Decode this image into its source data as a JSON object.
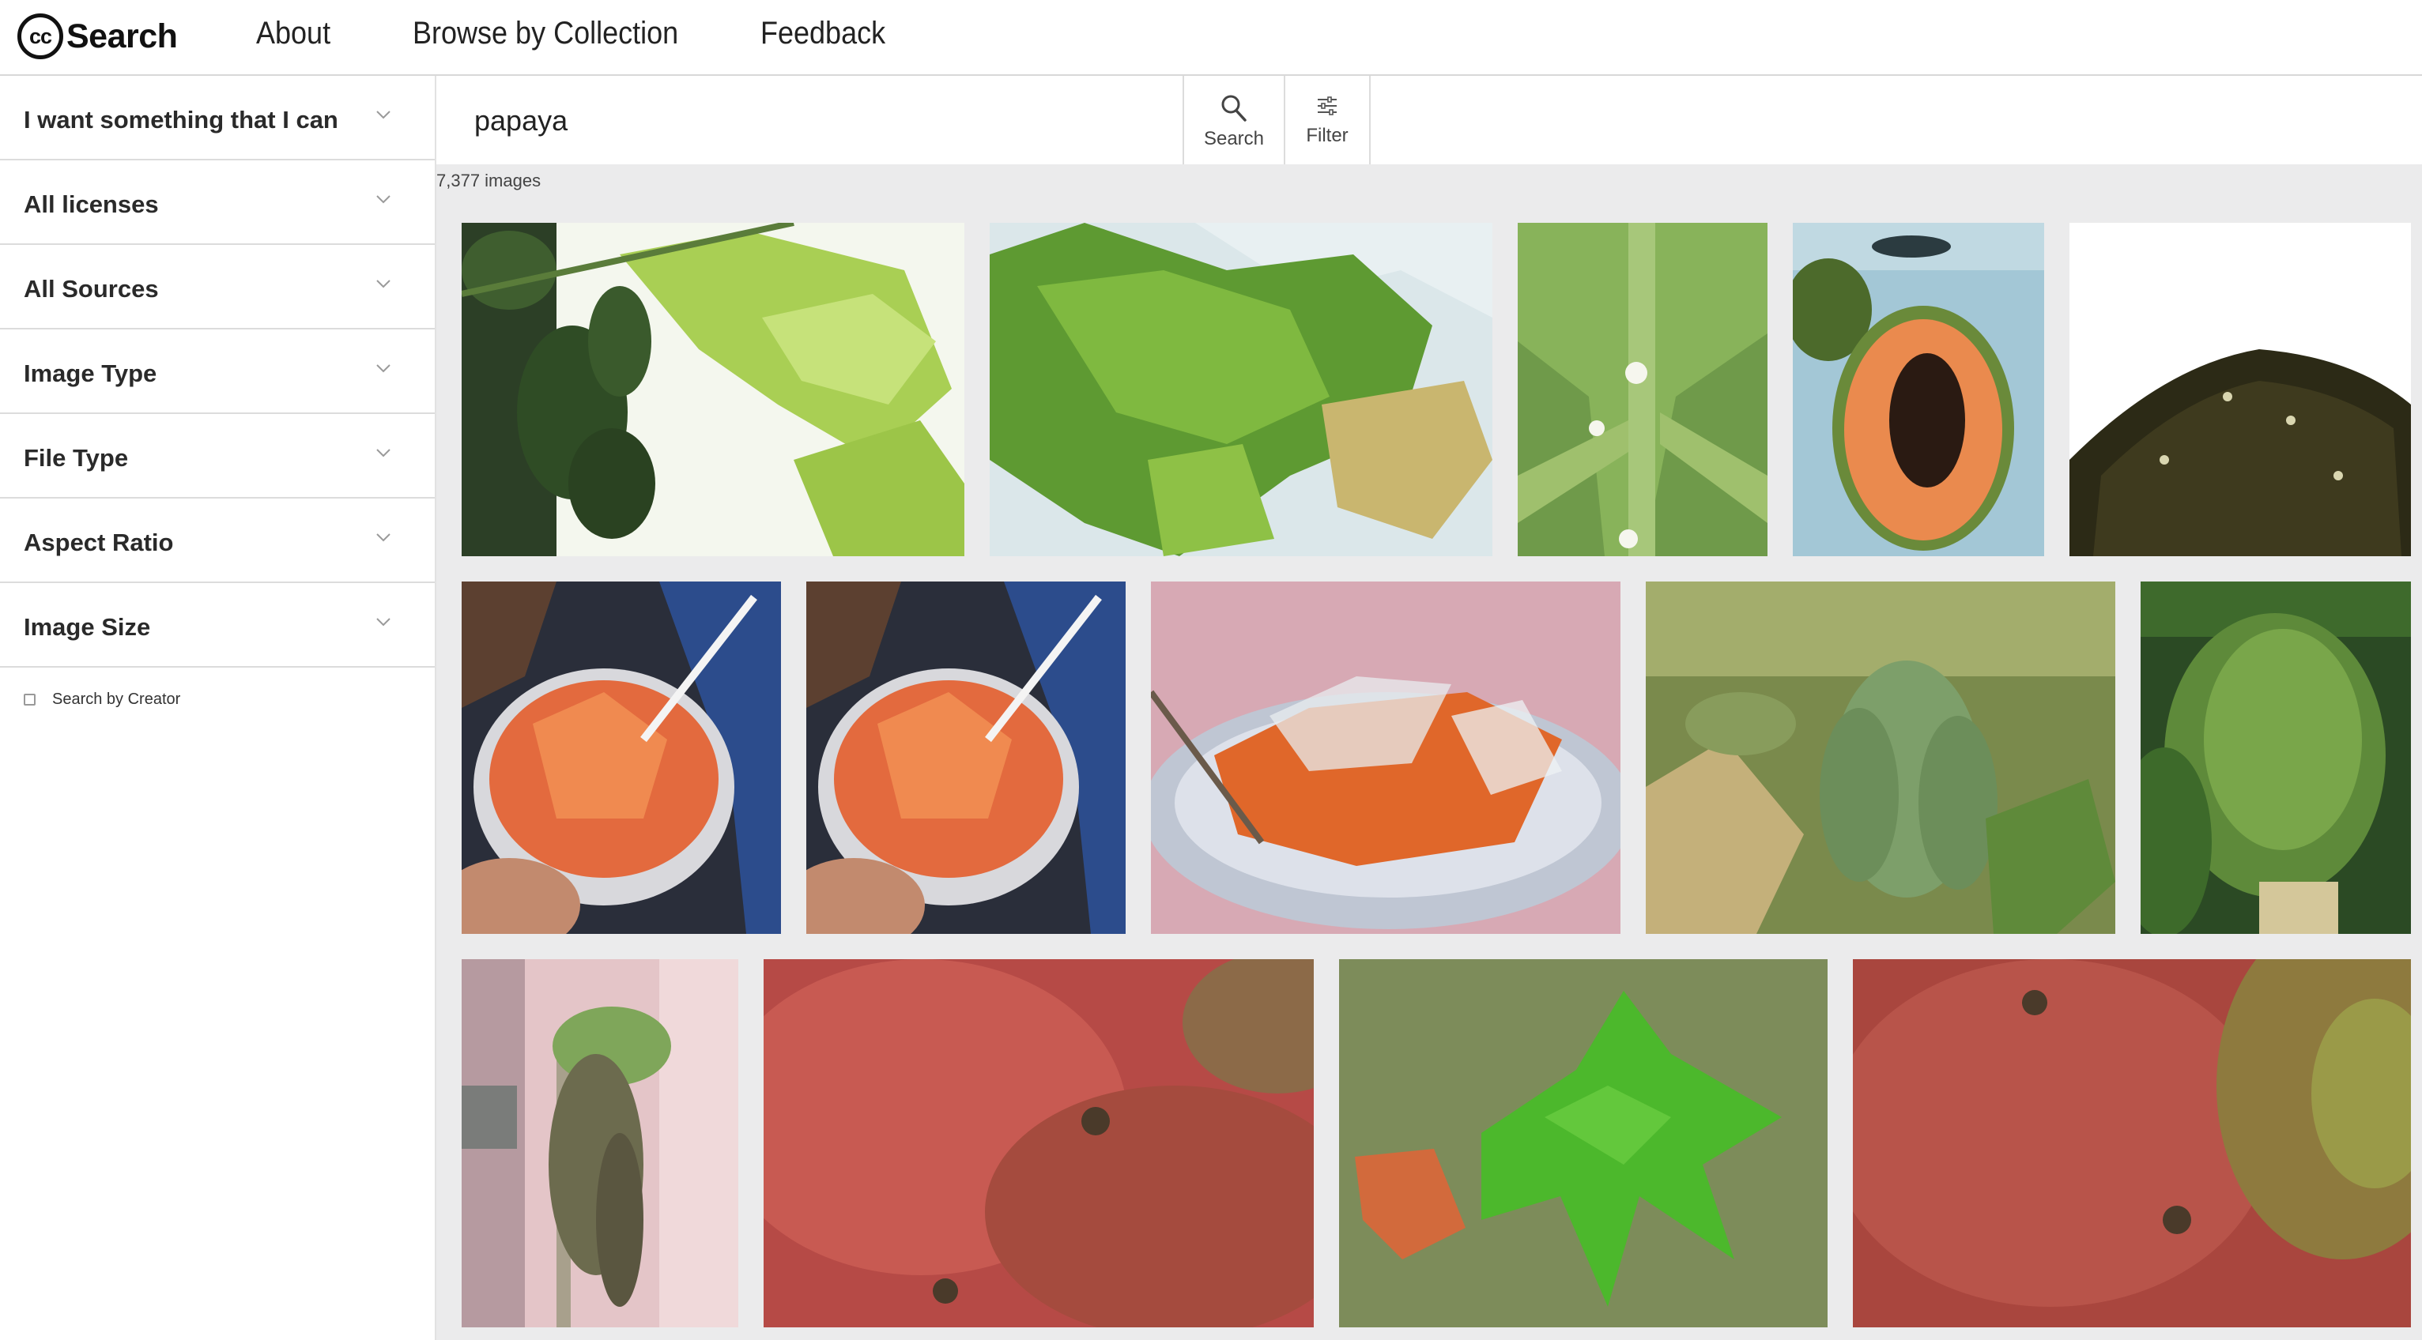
{
  "nav": {
    "logo_mark": "cc",
    "logo_text": "Search",
    "links": [
      "About",
      "Browse by Collection",
      "Feedback"
    ]
  },
  "sidebar": {
    "filters": [
      "I want something that I can",
      "All licenses",
      "All Sources",
      "Image Type",
      "File Type",
      "Aspect Ratio",
      "Image Size"
    ],
    "search_by_creator": "Search by Creator",
    "search_by_creator_checked": false
  },
  "search": {
    "query": "papaya",
    "search_label": "Search",
    "filter_label": "Filter",
    "search_icon": "search-icon",
    "filter_icon": "sliders-icon"
  },
  "results": {
    "count": "7,377 images",
    "images": [
      {
        "subject": "papaya-tree-leaves"
      },
      {
        "subject": "papaya-leaf-closeup"
      },
      {
        "subject": "papaya-flowers"
      },
      {
        "subject": "halved-papaya"
      },
      {
        "subject": "papaya-seeds"
      },
      {
        "subject": "papaya-bowl-fork"
      },
      {
        "subject": "papaya-bowl-fork"
      },
      {
        "subject": "papaya-plate-ice"
      },
      {
        "subject": "green-papaya-cluster"
      },
      {
        "subject": "green-papaya-closeup"
      },
      {
        "subject": "papaya-tree-building"
      },
      {
        "subject": "papaya-skin-closeup"
      },
      {
        "subject": "papaya-seedling"
      },
      {
        "subject": "papaya-skin-closeup"
      }
    ]
  },
  "colors": {
    "page_bg": "#ebebec",
    "border": "#dcdcdc",
    "text": "#222222"
  }
}
